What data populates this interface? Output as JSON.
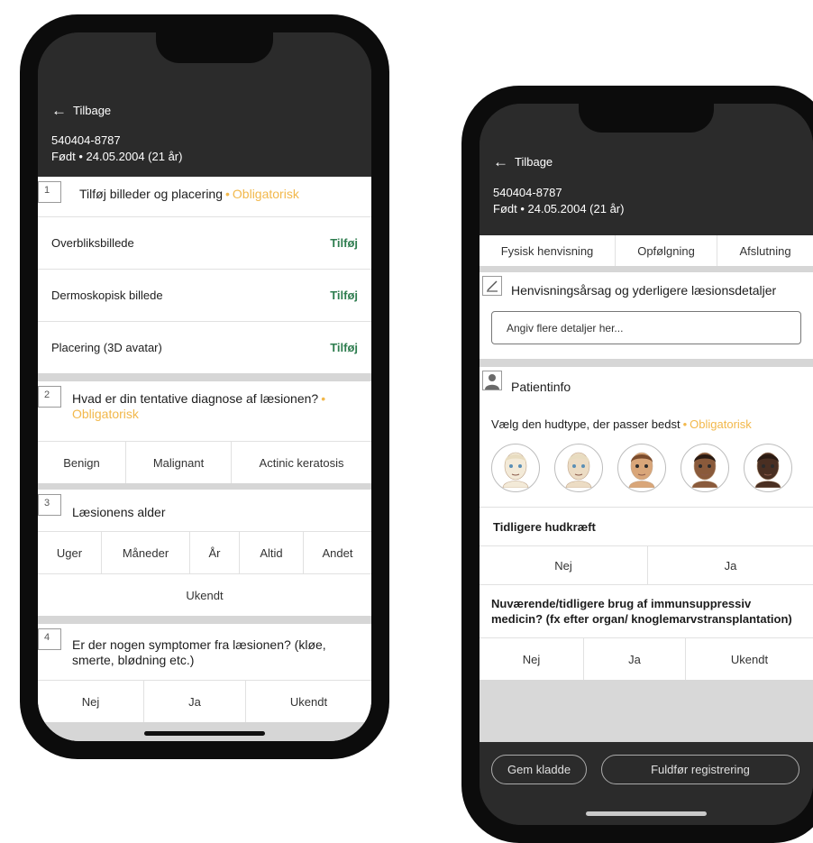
{
  "left": {
    "header": {
      "back_label": "Tilbage",
      "patient_id": "540404-8787",
      "birth_info": "Født • 24.05.2004 (21 år)"
    },
    "q1": {
      "number": "1",
      "title": "Tilføj billeder og placering",
      "required": "Obligatorisk",
      "rows": [
        {
          "label": "Overbliksbillede",
          "action": "Tilføj"
        },
        {
          "label": "Dermoskopisk billede",
          "action": "Tilføj"
        },
        {
          "label": "Placering (3D avatar)",
          "action": "Tilføj"
        }
      ]
    },
    "q2": {
      "number": "2",
      "title": "Hvad er din tentative diagnose af læsionen?",
      "required": "Obligatorisk",
      "options": [
        "Benign",
        "Malignant",
        "Actinic keratosis"
      ]
    },
    "q3": {
      "number": "3",
      "title": "Læsionens alder",
      "options": [
        "Uger",
        "Måneder",
        "År",
        "Altid",
        "Andet"
      ],
      "extra_option": "Ukendt"
    },
    "q4": {
      "number": "4",
      "title": "Er der nogen symptomer fra læsionen? (kløe, smerte, blødning etc.)",
      "options": [
        "Nej",
        "Ja",
        "Ukendt"
      ]
    }
  },
  "right": {
    "header": {
      "back_label": "Tilbage",
      "patient_id": "540404-8787",
      "birth_info": "Født • 24.05.2004 (21 år)"
    },
    "tabs": [
      "Fysisk henvisning",
      "Opfølgning",
      "Afslutning"
    ],
    "referral": {
      "title": "Henvisningsårsag og yderligere læsionsdetaljer",
      "placeholder": "Angiv flere detaljer her..."
    },
    "patient": {
      "title": "Patientinfo",
      "skin_type_label": "Vælg den hudtype, der passer bedst",
      "required": "Obligatorisk",
      "skin_colors": [
        "#f3ead8",
        "#ecdcc4",
        "#d9a679",
        "#8a5a3b",
        "#4a2f22"
      ]
    },
    "cancer": {
      "title": "Tidligere hudkræft",
      "options": [
        "Nej",
        "Ja"
      ]
    },
    "immuno": {
      "title": "Nuværende/tidligere brug af immunsuppressiv medicin? (fx efter organ/ knoglemarvstransplantation)",
      "options": [
        "Nej",
        "Ja",
        "Ukendt"
      ]
    },
    "footer": {
      "draft_button": "Gem kladde",
      "complete_button": "Fuldfør registrering"
    }
  },
  "colors": {
    "header_bg": "#2b2b2b",
    "accent_green": "#2e7d4f",
    "required_orange": "#f2b84b"
  }
}
